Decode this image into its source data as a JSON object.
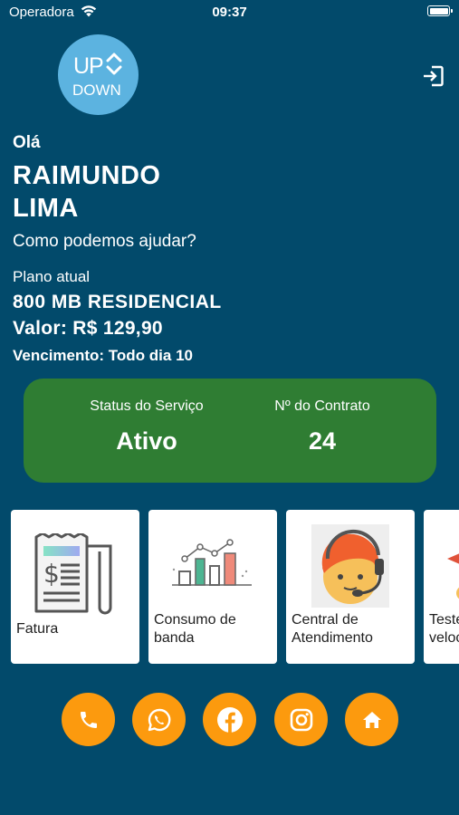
{
  "status_bar": {
    "carrier": "Operadora",
    "time": "09:37"
  },
  "logo": {
    "top": "UP",
    "bottom": "DOWN"
  },
  "greeting": "Olá",
  "user": {
    "name": "RAIMUNDO LIMA"
  },
  "help_text": "Como podemos ajudar?",
  "plan": {
    "label": "Plano atual",
    "name": "800 MB RESIDENCIAL",
    "value": "Valor: R$ 129,90",
    "due": "Vencimento: Todo dia 10"
  },
  "service_card": {
    "status_label": "Status do Serviço",
    "status_value": "Ativo",
    "contract_label": "Nº do Contrato",
    "contract_value": "24"
  },
  "tiles": [
    {
      "label": "Fatura",
      "icon": "invoice-icon"
    },
    {
      "label": "Consumo de banda",
      "icon": "bar-chart-icon"
    },
    {
      "label": "Central de Atendimento",
      "icon": "support-agent-icon"
    },
    {
      "label": "Teste de velocidade",
      "icon": "speed-test-icon"
    }
  ],
  "actions": [
    {
      "icon": "phone-icon"
    },
    {
      "icon": "whatsapp-icon"
    },
    {
      "icon": "facebook-icon"
    },
    {
      "icon": "instagram-icon"
    },
    {
      "icon": "home-icon"
    }
  ],
  "colors": {
    "background": "#024a6b",
    "logo_circle": "#5cb3e0",
    "status_card": "#2f7d33",
    "action_button": "#fc9a0e",
    "tile": "#ffffff"
  }
}
